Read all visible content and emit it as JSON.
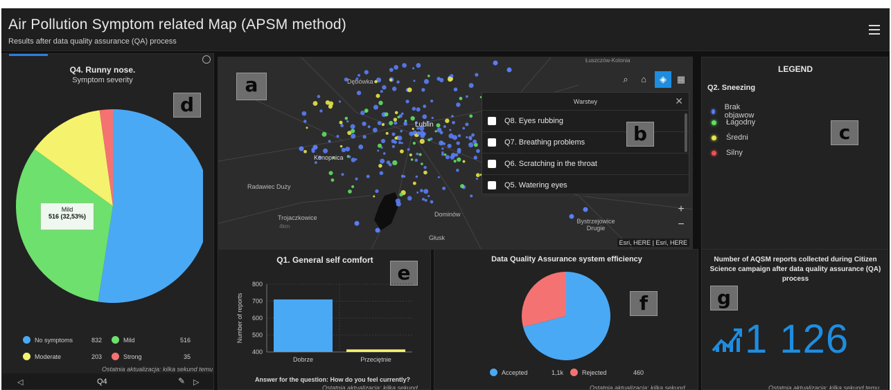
{
  "header": {
    "title": "Air Pollution Symptom related Map (APSM method)",
    "subtitle": "Results after data quality assurance (QA) process"
  },
  "panel_d": {
    "badge": "d",
    "title": "Q4. Runny nose.",
    "subtitle": "Symptom severity",
    "tooltip_label": "Mild",
    "tooltip_value": "516 (32,53%)",
    "legend": [
      {
        "label": "No symptoms",
        "value": "832",
        "color": "#4aa9f5"
      },
      {
        "label": "Mild",
        "value": "516",
        "color": "#6ee06e"
      },
      {
        "label": "Moderate",
        "value": "203",
        "color": "#f5f26e"
      },
      {
        "label": "Strong",
        "value": "35",
        "color": "#f57272"
      }
    ],
    "footer": "Ostatnia aktualizacja: kilka sekund temu",
    "nav_label": "Q4"
  },
  "panel_a": {
    "badge": "a",
    "places": [
      "Dębówka",
      "Lublin",
      "Konopnica",
      "Radawiec Duży",
      "Trojaczkowice",
      "Dominów",
      "Bystrzejowice Drugie",
      "Głusk",
      "Łuszczów-Kolonia"
    ],
    "scale_label": "4km",
    "attribution": "Esri, HERE | Esri, HERE",
    "zoom_in": "+",
    "zoom_out": "−"
  },
  "panel_b": {
    "badge": "b",
    "title": "Warstwy",
    "layers": [
      "Q8. Eyes rubbing",
      "Q7. Breathing problems",
      "Q6. Scratching in the throat",
      "Q5. Watering eyes"
    ]
  },
  "panel_c": {
    "badge": "c",
    "title": "LEGEND",
    "question": "Q2. Sneezing",
    "items": [
      {
        "label": "Brak objawow",
        "color": "#5a7df5"
      },
      {
        "label": "Łagodny",
        "color": "#5fe05f"
      },
      {
        "label": "Średni",
        "color": "#e6e64a"
      },
      {
        "label": "Silny",
        "color": "#f05050"
      }
    ]
  },
  "panel_e": {
    "badge": "e",
    "title": "Q1. General self comfort",
    "ylabel": "Number of reports",
    "xlabel": "Answer for the question: How do you feel currently?",
    "footer": "Ostatnia aktualizacja: kilka sekund temu"
  },
  "panel_f": {
    "badge": "f",
    "title": "Data Quality Assurance system efficiency",
    "legend": [
      {
        "label": "Accepted",
        "value": "1,1k",
        "color": "#4aa9f5"
      },
      {
        "label": "Rejected",
        "value": "460",
        "color": "#f57272"
      }
    ],
    "footer": "Ostatnia aktualizacja: kilka sekund temu"
  },
  "panel_g": {
    "badge": "g",
    "title": "Number of AQSM reports collected during Citizen Science campaign after data quality assurance (QA) process",
    "value": "1 126",
    "footer": "Ostatnia aktualizacja: kilka sekund temu"
  },
  "chart_data": [
    {
      "type": "pie",
      "title": "Q4. Runny nose.",
      "subtitle": "Symptom severity",
      "categories": [
        "No symptoms",
        "Mild",
        "Moderate",
        "Strong"
      ],
      "values": [
        832,
        516,
        203,
        35
      ],
      "colors": [
        "#4aa9f5",
        "#6ee06e",
        "#f5f26e",
        "#f57272"
      ]
    },
    {
      "type": "bar",
      "title": "Q1. General self comfort",
      "categories": [
        "Dobrze",
        "Przeciętnie"
      ],
      "values": [
        710,
        415
      ],
      "ylabel": "Number of reports",
      "xlabel": "Answer for the question: How do you feel currently?",
      "ylim": [
        400,
        800
      ],
      "yticks": [
        400,
        500,
        600,
        700,
        800
      ],
      "colors": [
        "#4aa9f5",
        "#f5f26e"
      ]
    },
    {
      "type": "pie",
      "title": "Data Quality Assurance system efficiency",
      "categories": [
        "Accepted",
        "Rejected"
      ],
      "values": [
        1126,
        460
      ],
      "colors": [
        "#4aa9f5",
        "#f57272"
      ]
    }
  ]
}
